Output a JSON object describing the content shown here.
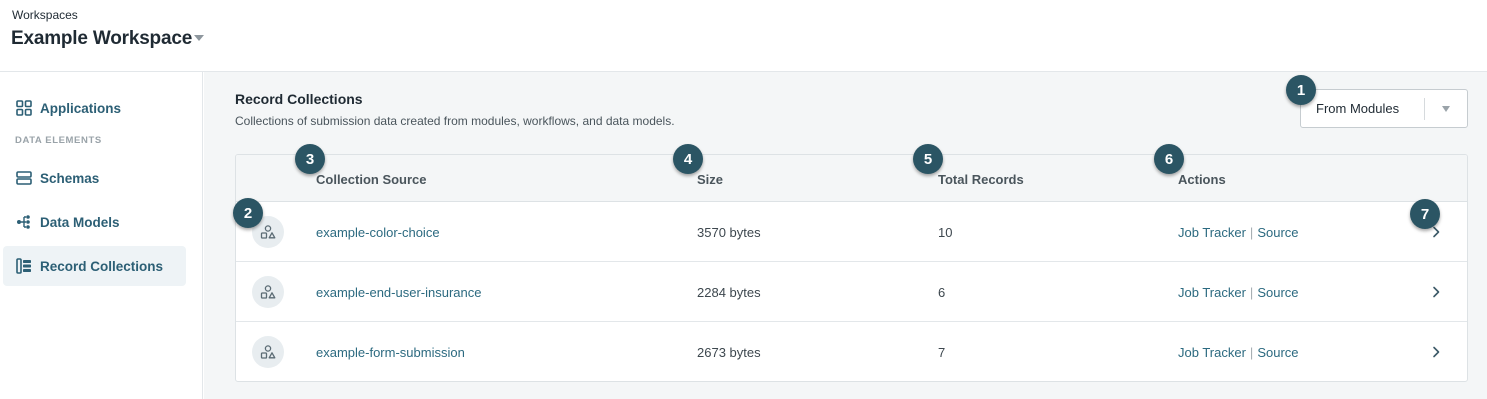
{
  "header": {
    "workspaces_label": "Workspaces",
    "workspace_name": "Example Workspace"
  },
  "sidebar": {
    "items": [
      {
        "label": "Applications",
        "icon": "grid-icon"
      },
      {
        "label": "Schemas",
        "icon": "schema-icon"
      },
      {
        "label": "Data Models",
        "icon": "data-model-icon"
      },
      {
        "label": "Record Collections",
        "icon": "record-collections-icon"
      }
    ],
    "section_label": "DATA ELEMENTS",
    "active_item": "Record Collections"
  },
  "main": {
    "title": "Record Collections",
    "description": "Collections of submission data created from modules, workflows, and data models.",
    "filter": {
      "selected": "From Modules"
    }
  },
  "table": {
    "columns": [
      "Collection Source",
      "Size",
      "Total Records",
      "Actions"
    ],
    "rows": [
      {
        "source": "example-color-choice",
        "size": "3570 bytes",
        "records": "10",
        "action_1": "Job Tracker",
        "action_2": "Source"
      },
      {
        "source": "example-end-user-insurance",
        "size": "2284 bytes",
        "records": "6",
        "action_1": "Job Tracker",
        "action_2": "Source"
      },
      {
        "source": "example-form-submission",
        "size": "2673 bytes",
        "records": "7",
        "action_1": "Job Tracker",
        "action_2": "Source"
      }
    ],
    "separator": "|"
  },
  "callouts": [
    "1",
    "2",
    "3",
    "4",
    "5",
    "6",
    "7"
  ],
  "colors": {
    "accent": "#2c6a80",
    "nav_text": "#2c5f75",
    "badge": "#2b5564",
    "background": "#f4f6f7"
  }
}
